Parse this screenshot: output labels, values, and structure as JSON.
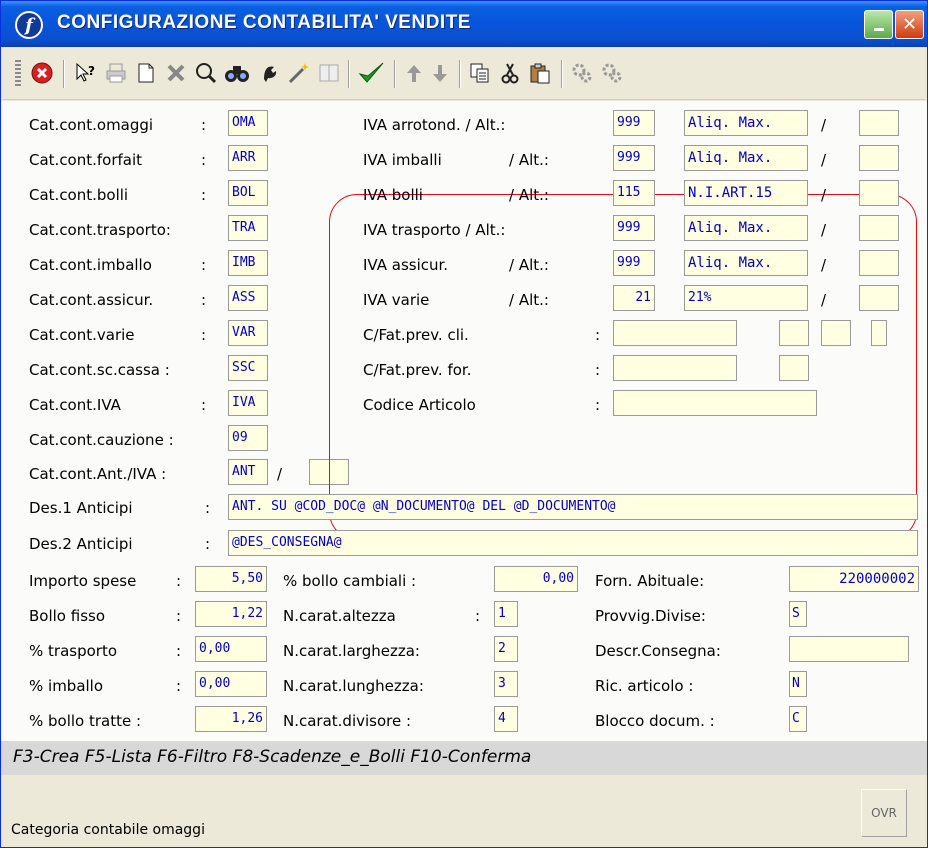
{
  "window": {
    "title": "CONFIGURAZIONE CONTABILITA' VENDITE"
  },
  "toolbar": {
    "icons": [
      "stop-icon",
      "help-icon",
      "print-icon",
      "new-icon",
      "delete-icon",
      "zoom-icon",
      "find-icon",
      "tools-icon",
      "wand-icon",
      "panel-icon",
      "confirm-icon",
      "up-icon",
      "down-icon",
      "copy-icon",
      "cut-icon",
      "paste-icon",
      "gears-icon",
      "gears2-icon"
    ]
  },
  "left": [
    {
      "label": "Cat.cont.omaggi",
      "colon": ":",
      "value": "OMA"
    },
    {
      "label": "Cat.cont.forfait",
      "colon": ":",
      "value": "ARR"
    },
    {
      "label": "Cat.cont.bolli",
      "colon": ":",
      "value": "BOL"
    },
    {
      "label": "Cat.cont.trasporto:",
      "colon": "",
      "value": "TRA"
    },
    {
      "label": "Cat.cont.imballo",
      "colon": ":",
      "value": "IMB"
    },
    {
      "label": "Cat.cont.assicur.",
      "colon": ":",
      "value": "ASS"
    },
    {
      "label": "Cat.cont.varie",
      "colon": ":",
      "value": "VAR"
    },
    {
      "label": "Cat.cont.sc.cassa :",
      "colon": "",
      "value": "SSC"
    },
    {
      "label": "Cat.cont.IVA",
      "colon": ":",
      "value": "IVA"
    },
    {
      "label": "Cat.cont.cauzione :",
      "colon": "",
      "value": "09"
    },
    {
      "label": "Cat.cont.Ant./IVA :",
      "colon": "",
      "value": "ANT",
      "slash": "/",
      "extra": ""
    }
  ],
  "iva": [
    {
      "label": "IVA arrotond. / Alt.:",
      "code": "999",
      "desc": "Aliq. Max.",
      "slash": "/",
      "alt": ""
    },
    {
      "label": "IVA imballi",
      "alt_label": "/ Alt.:",
      "code": "999",
      "desc": "Aliq. Max.",
      "slash": "/",
      "alt": ""
    },
    {
      "label": "IVA bolli",
      "alt_label": "/ Alt.:",
      "code": "115",
      "desc": "N.I.ART.15",
      "slash": "/",
      "alt": ""
    },
    {
      "label": "IVA trasporto / Alt.:",
      "code": "999",
      "desc": "Aliq. Max.",
      "slash": "/",
      "alt": ""
    },
    {
      "label": "IVA assicur.",
      "alt_label": "/ Alt.:",
      "code": "999",
      "desc": "Aliq. Max.",
      "slash": "/",
      "alt": ""
    },
    {
      "label": "IVA varie",
      "alt_label": "/ Alt.:",
      "code": "21",
      "desc": "21%",
      "slash": "/",
      "alt": ""
    }
  ],
  "fatprev": [
    {
      "label": "C/Fat.prev. cli.",
      "colon": ":"
    },
    {
      "label": "C/Fat.prev. for.",
      "colon": ":"
    },
    {
      "label": "Codice Articolo",
      "colon": ":"
    }
  ],
  "anticipi": [
    {
      "label": "Des.1 Anticipi",
      "colon": ":",
      "value": "ANT. SU @COD_DOC@ @N_DOCUMENTO@ DEL @D_DOCUMENTO@"
    },
    {
      "label": "Des.2 Anticipi",
      "colon": ":",
      "value": "@DES_CONSEGNA@"
    }
  ],
  "col1": [
    {
      "label": "Importo spese",
      "colon": ":",
      "value": "5,50"
    },
    {
      "label": "Bollo fisso",
      "colon": ":",
      "value": "1,22"
    },
    {
      "label": "% trasporto",
      "colon": ":",
      "value": "0,00"
    },
    {
      "label": "% imballo",
      "colon": ":",
      "value": "0,00"
    },
    {
      "label": "% bollo tratte :",
      "colon": "",
      "value": "1,26"
    }
  ],
  "col2": [
    {
      "label": "% bollo cambiali :",
      "colon": "",
      "value": "0,00"
    },
    {
      "label": "N.carat.altezza",
      "colon": ":",
      "value": "1"
    },
    {
      "label": "N.carat.larghezza:",
      "colon": "",
      "value": "2"
    },
    {
      "label": "N.carat.lunghezza:",
      "colon": "",
      "value": "3"
    },
    {
      "label": "N.carat.divisore :",
      "colon": "",
      "value": "4"
    }
  ],
  "col3": [
    {
      "label": "Forn. Abituale:",
      "value": "220000002"
    },
    {
      "label": "Provvig.Divise:",
      "value": "S"
    },
    {
      "label": "Descr.Consegna:",
      "value": ""
    },
    {
      "label": "Ric. articolo :",
      "value": "N"
    },
    {
      "label": "Blocco docum. :",
      "value": "C"
    }
  ],
  "fkeys": "F3-Crea F5-Lista F6-Filtro F8-Scadenze_e_Bolli F10-Conferma",
  "status": {
    "message": "Categoria contabile omaggi",
    "mode": "OVR"
  }
}
